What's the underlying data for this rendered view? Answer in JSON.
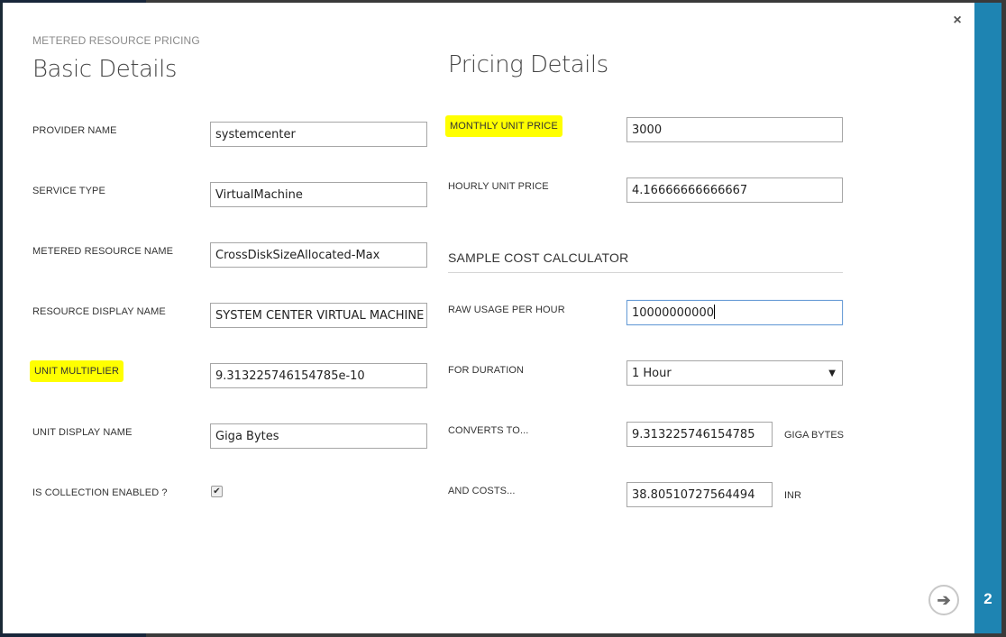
{
  "dialog": {
    "subtitle": "METERED RESOURCE PRICING",
    "close_icon": "×",
    "step_number": "2",
    "next_icon": "➔"
  },
  "basic": {
    "title": "Basic Details",
    "fields": [
      {
        "label": "PROVIDER NAME",
        "value": "systemcenter"
      },
      {
        "label": "SERVICE TYPE",
        "value": "VirtualMachine"
      },
      {
        "label": "METERED RESOURCE NAME",
        "value": "CrossDiskSizeAllocated-Max"
      },
      {
        "label": "RESOURCE DISPLAY NAME",
        "value": "SYSTEM CENTER VIRTUAL MACHINE - C"
      },
      {
        "label": "UNIT MULTIPLIER",
        "value": "9.313225746154785e-10",
        "highlighted": true
      },
      {
        "label": "UNIT DISPLAY NAME",
        "value": "Giga Bytes"
      }
    ],
    "collection": {
      "label": "IS COLLECTION ENABLED ?",
      "checked": true,
      "check_glyph": "✔"
    }
  },
  "pricing": {
    "title": "Pricing Details",
    "monthly": {
      "label": "MONTHLY UNIT PRICE",
      "value": "3000",
      "highlighted": true
    },
    "hourly": {
      "label": "HOURLY UNIT PRICE",
      "value": "4.16666666666667"
    },
    "calculator": {
      "title": "SAMPLE COST CALCULATOR",
      "raw_usage": {
        "label": "RAW USAGE PER HOUR",
        "value": "10000000000"
      },
      "duration": {
        "label": "FOR DURATION",
        "selected": "1 Hour",
        "arrow": "▼"
      },
      "converts": {
        "label": "CONVERTS TO...",
        "value": "9.313225746154785",
        "unit": "GIGA BYTES"
      },
      "costs": {
        "label": "AND COSTS...",
        "value": "38.80510727564494",
        "unit": "INR"
      }
    }
  },
  "colors": {
    "accent": "#1e84b2",
    "highlight": "#ffff00"
  }
}
